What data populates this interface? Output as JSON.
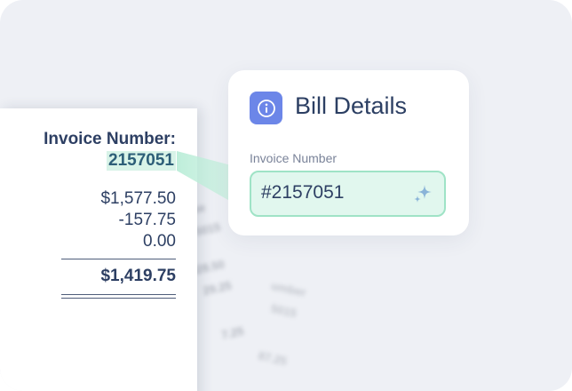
{
  "receipt": {
    "invoice_label": "Invoice Number:",
    "invoice_number": "2157051",
    "lines": [
      "$1,577.50",
      "-157.75",
      "0.00"
    ],
    "total": "$1,419.75"
  },
  "background_receipts": {
    "fragments_a": [
      "mbe",
      "5015",
      "828.50",
      "29.25",
      "7.25"
    ],
    "fragments_b": [
      "umber",
      "5015",
      "87.25"
    ]
  },
  "card": {
    "title": "Bill Details",
    "field_label": "Invoice Number",
    "field_value": "#2157051",
    "info_icon": "info-icon",
    "sparkle_icon": "sparkle-icon"
  },
  "colors": {
    "accent_blue": "#6c86e8",
    "highlight_green": "#d8f3e8",
    "field_border": "#9fe3c6",
    "text_navy": "#2d3f63"
  }
}
